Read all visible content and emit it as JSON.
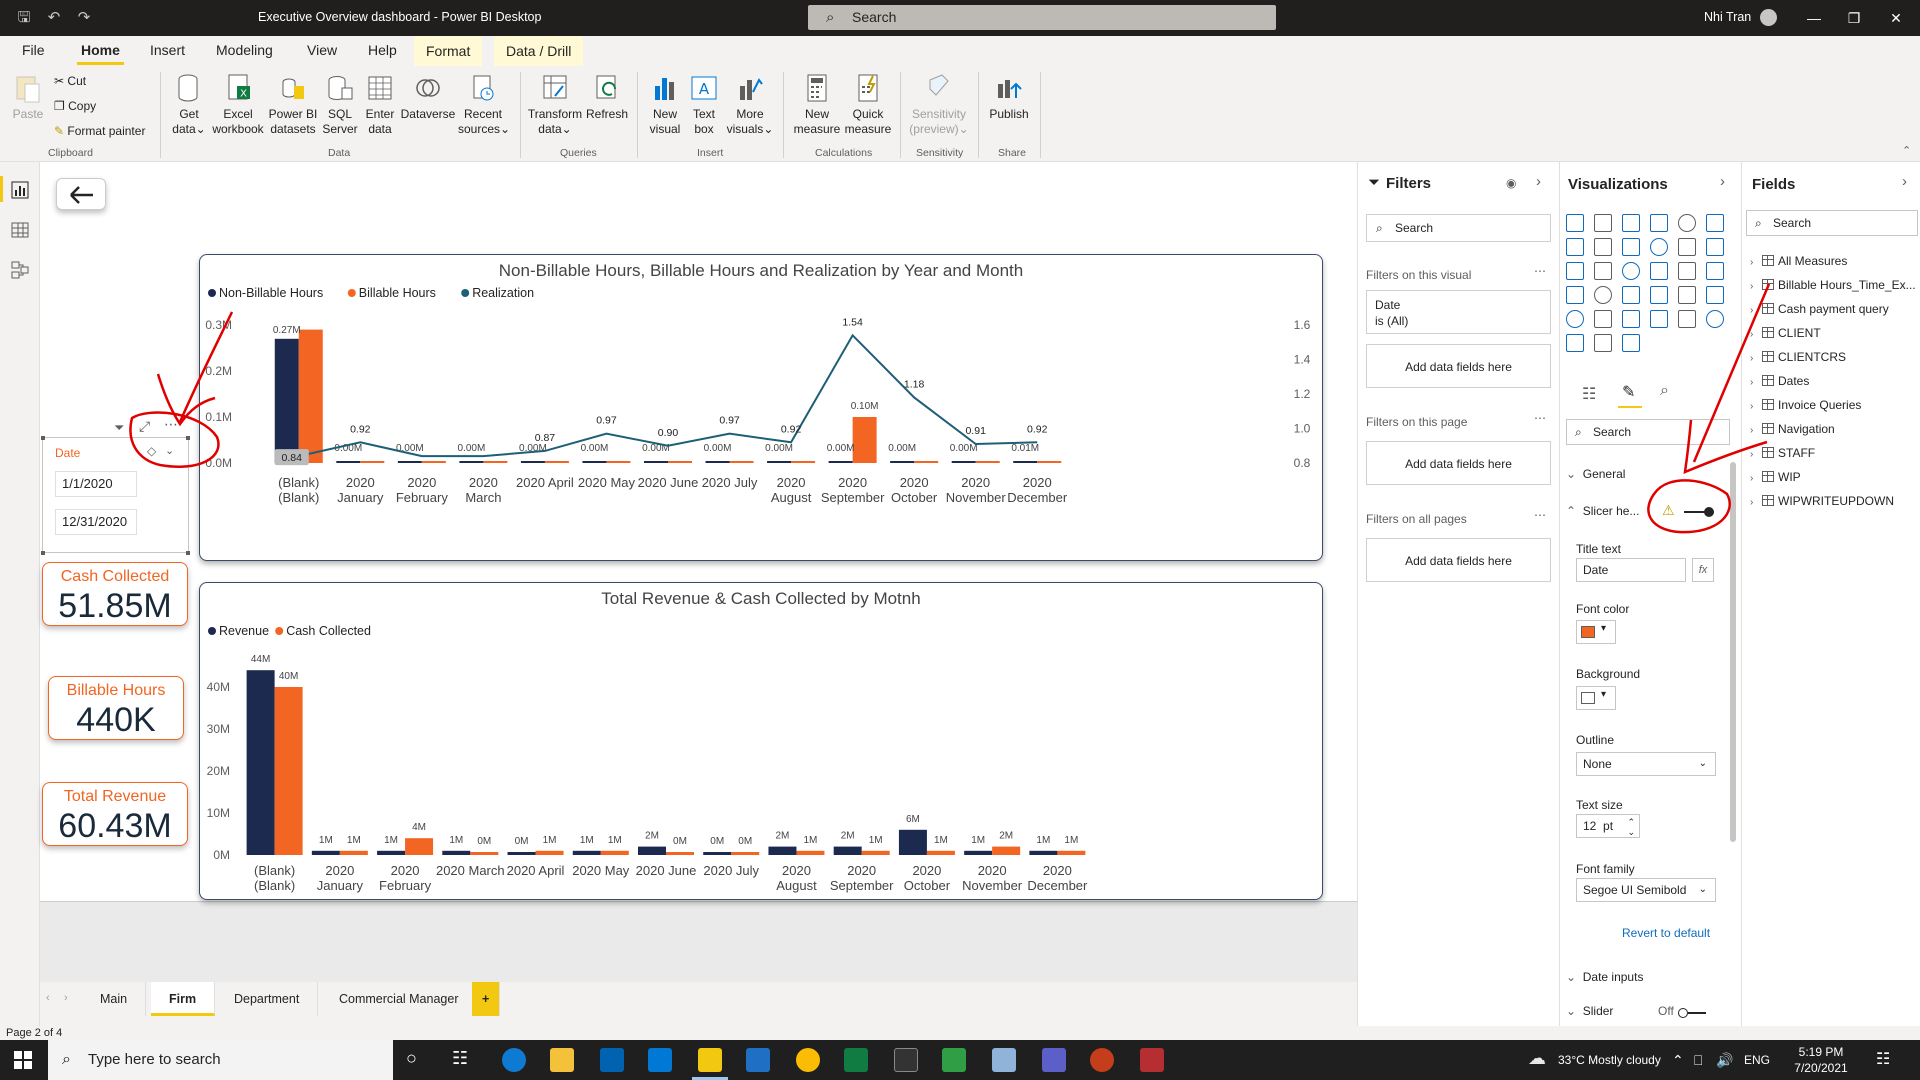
{
  "window": {
    "title": "Executive Overview dashboard - Power BI Desktop",
    "search_placeholder": "Search",
    "user": "Nhi Tran"
  },
  "menu": [
    "File",
    "Home",
    "Insert",
    "Modeling",
    "View",
    "Help",
    "Format",
    "Data / Drill"
  ],
  "ribbon": {
    "clipboard": {
      "paste": "Paste",
      "cut": "Cut",
      "copy": "Copy",
      "format_painter": "Format painter",
      "group": "Clipboard"
    },
    "data": {
      "get_data": [
        "Get",
        "data"
      ],
      "excel": [
        "Excel",
        "workbook"
      ],
      "powerbi": [
        "Power BI",
        "datasets"
      ],
      "sql": [
        "SQL",
        "Server"
      ],
      "enter": [
        "Enter",
        "data"
      ],
      "dataverse": [
        "Dataverse",
        ""
      ],
      "recent": [
        "Recent",
        "sources"
      ],
      "group": "Data"
    },
    "queries": {
      "transform": [
        "Transform",
        "data"
      ],
      "refresh": [
        "Refresh",
        ""
      ],
      "group": "Queries"
    },
    "insert": {
      "new_visual": [
        "New",
        "visual"
      ],
      "text_box": [
        "Text",
        "box"
      ],
      "more_visuals": [
        "More",
        "visuals"
      ],
      "group": "Insert"
    },
    "calculations": {
      "new_measure": [
        "New",
        "measure"
      ],
      "quick_measure": [
        "Quick",
        "measure"
      ],
      "group": "Calculations"
    },
    "sensitivity": {
      "label": [
        "Sensitivity",
        "(preview)"
      ],
      "group": "Sensitivity"
    },
    "share": {
      "publish": [
        "Publish",
        ""
      ],
      "group": "Share"
    }
  },
  "slicer": {
    "header": "Date",
    "start": "1/1/2020",
    "end": "12/31/2020"
  },
  "kpis": [
    {
      "label": "Cash Collected",
      "value": "51.85M"
    },
    {
      "label": "Billable Hours",
      "value": "440K"
    },
    {
      "label": "Total Revenue",
      "value": "60.43M"
    }
  ],
  "colors": {
    "navy": "#1b2a4e",
    "orange": "#f26522",
    "teal": "#1d5f76",
    "accent": "#f2c811"
  },
  "chart_data": [
    {
      "type": "bar",
      "title": "Non-Billable Hours, Billable Hours and Realization by Year and Month",
      "legend": [
        "Non-Billable Hours",
        "Billable Hours",
        "Realization"
      ],
      "legend_position": "top-left",
      "categories": [
        [
          "(Blank)",
          "(Blank)"
        ],
        [
          "2020",
          "January"
        ],
        [
          "2020",
          "February"
        ],
        [
          "2020",
          "March"
        ],
        [
          "2020 April",
          ""
        ],
        [
          "2020 May",
          ""
        ],
        [
          "2020 June",
          ""
        ],
        [
          "2020 July",
          ""
        ],
        [
          "2020",
          "August"
        ],
        [
          "2020",
          "September"
        ],
        [
          "2020",
          "October"
        ],
        [
          "2020",
          "November"
        ],
        [
          "2020",
          "December"
        ]
      ],
      "y_ticks": [
        "0.0M",
        "0.1M",
        "0.2M",
        "0.3M"
      ],
      "y2_ticks": [
        "0.8",
        "1.0",
        "1.2",
        "1.4",
        "1.6"
      ],
      "ylim": [
        0,
        0.3
      ],
      "y2lim": [
        0.8,
        1.6
      ],
      "series": [
        {
          "name": "Non-Billable Hours",
          "values": [
            0.27,
            0.001,
            0.001,
            0.001,
            0.001,
            0.001,
            0.001,
            0.001,
            0.001,
            0.001,
            0.001,
            0.001,
            0.004
          ]
        },
        {
          "name": "Billable Hours",
          "values": [
            0.29,
            0.001,
            0.001,
            0.001,
            0.002,
            0.001,
            0.001,
            0.001,
            0.001,
            0.1,
            0.001,
            0.001,
            0.001
          ]
        },
        {
          "name": "Realization",
          "values": [
            0.84,
            0.92,
            0.84,
            0.84,
            0.87,
            0.97,
            0.9,
            0.97,
            0.92,
            1.54,
            1.18,
            0.91,
            0.92
          ]
        }
      ],
      "data_labels": {
        "non_billable": [
          "0.27M",
          "0.00M",
          "0.00M",
          "0.00M",
          "0.00M",
          "0.00M",
          "0.00M",
          "0.00M",
          "0.00M",
          "0.00M",
          "0.00M",
          "0.00M",
          "0.01M"
        ],
        "billable_top": "0.10M",
        "realization": [
          "0.84",
          "0.92",
          "",
          "",
          "0.87",
          "0.97",
          "0.90",
          "0.97",
          "0.92",
          "1.54",
          "1.18",
          "0.91",
          "0.92"
        ]
      }
    },
    {
      "type": "bar",
      "title": "Total Revenue & Cash Collected by Motnh",
      "legend": [
        "Revenue",
        "Cash Collected"
      ],
      "legend_position": "top-left",
      "categories": [
        [
          "(Blank)",
          "(Blank)"
        ],
        [
          "2020",
          "January"
        ],
        [
          "2020",
          "February"
        ],
        [
          "2020 March",
          ""
        ],
        [
          "2020 April",
          ""
        ],
        [
          "2020 May",
          ""
        ],
        [
          "2020 June",
          ""
        ],
        [
          "2020 July",
          ""
        ],
        [
          "2020",
          "August"
        ],
        [
          "2020",
          "September"
        ],
        [
          "2020",
          "October"
        ],
        [
          "2020",
          "November"
        ],
        [
          "2020",
          "December"
        ]
      ],
      "y_ticks": [
        "0M",
        "10M",
        "20M",
        "30M",
        "40M"
      ],
      "ylim": [
        0,
        40
      ],
      "series": [
        {
          "name": "Revenue",
          "values": [
            44,
            1,
            1,
            1,
            0.4,
            1,
            2,
            0.4,
            2,
            2,
            6,
            1,
            1
          ]
        },
        {
          "name": "Cash Collected",
          "values": [
            40,
            1,
            4,
            0.4,
            1,
            1,
            0.4,
            0.4,
            1,
            1,
            1,
            2,
            1
          ]
        }
      ],
      "data_labels": {
        "revenue": [
          "44M",
          "1M",
          "1M",
          "1M",
          "0M",
          "1M",
          "2M",
          "0M",
          "2M",
          "2M",
          "6M",
          "1M",
          "1M"
        ],
        "cash": [
          "40M",
          "1M",
          "4M",
          "0M",
          "1M",
          "1M",
          "0M",
          "0M",
          "1M",
          "1M",
          "1M",
          "2M",
          "1M"
        ]
      }
    }
  ],
  "page_tabs": [
    "Main",
    "Firm",
    "Department",
    "Commercial Manager",
    "+"
  ],
  "status": "Page 2 of 4",
  "filters": {
    "title": "Filters",
    "search": "Search",
    "on_visual": "Filters on this visual",
    "date_card": [
      "Date",
      "is (All)"
    ],
    "add": "Add data fields here",
    "on_page": "Filters on this page",
    "on_all": "Filters on all pages"
  },
  "viz": {
    "title": "Visualizations",
    "search": "Search",
    "general": "General",
    "slicer_header": "Slicer he...",
    "title_text_label": "Title text",
    "title_text_value": "Date",
    "font_color": "Font color",
    "background": "Background",
    "outline": "Outline",
    "outline_value": "None",
    "text_size": "Text size",
    "text_size_value": "12",
    "text_size_unit": "pt",
    "font_family": "Font family",
    "font_family_value": "Segoe UI Semibold",
    "revert": "Revert to default",
    "date_inputs": "Date inputs",
    "slider": "Slider",
    "slider_state": "Off",
    "fx": "fx",
    "font_color_hex": "#f26522"
  },
  "fields": {
    "title": "Fields",
    "search": "Search",
    "items": [
      "All Measures",
      "Billable Hours_Time_Ex...",
      "Cash payment query",
      "CLIENT",
      "CLIENTCRS",
      "Dates",
      "Invoice Queries",
      "Navigation",
      "STAFF",
      "WIP",
      "WIPWRITEUPDOWN"
    ]
  },
  "taskbar": {
    "search": "Type here to search",
    "weather": "33°C  Mostly cloudy",
    "lang": "ENG",
    "time": "5:19 PM",
    "date": "7/20/2021"
  }
}
